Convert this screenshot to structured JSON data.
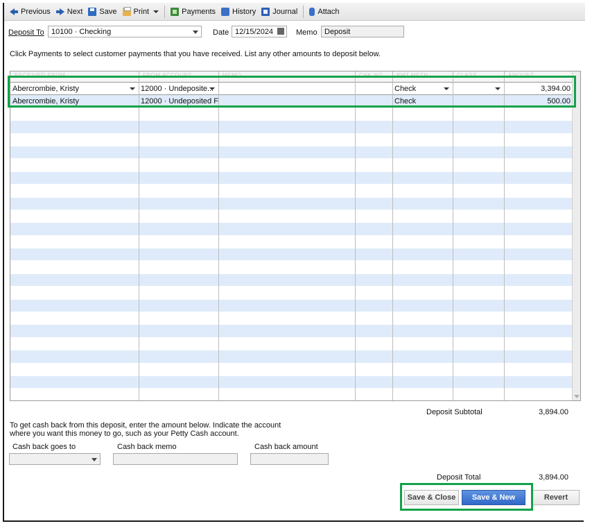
{
  "toolbar": {
    "previous": "Previous",
    "next": "Next",
    "save": "Save",
    "print": "Print",
    "payments": "Payments",
    "history": "History",
    "journal": "Journal",
    "attach": "Attach"
  },
  "header": {
    "deposit_to_label": "Deposit To",
    "deposit_to_value": "10100 · Checking",
    "date_label": "Date",
    "date_value": "12/15/2024",
    "memo_label": "Memo",
    "memo_value": "Deposit"
  },
  "instructions": "Click Payments to select customer payments that you have received. List any other amounts to deposit below.",
  "grid": {
    "columns": [
      "RECEIVED FROM",
      "FROM ACCOUNT",
      "MEMO",
      "CHK NO.",
      "PMT METH.",
      "CLASS",
      "AMOUNT"
    ],
    "rows": [
      {
        "received_from": "Abercrombie, Kristy",
        "from_account": "12000 · Undeposite...",
        "memo": "",
        "chk_no": "",
        "pmt_meth": "Check",
        "class": "",
        "amount": "3,394.00"
      },
      {
        "received_from": "Abercrombie, Kristy",
        "from_account": "12000 · Undeposited F...",
        "memo": "",
        "chk_no": "",
        "pmt_meth": "Check",
        "class": "",
        "amount": "500.00"
      }
    ]
  },
  "totals": {
    "subtotal_label": "Deposit Subtotal",
    "subtotal_value": "3,894.00",
    "total_label": "Deposit Total",
    "total_value": "3,894.00"
  },
  "cash_back": {
    "text_line1": "To get cash back from this deposit, enter the amount below.  Indicate the account",
    "text_line2": "where you want this money to go, such as your Petty Cash account.",
    "goes_to_label": "Cash back goes to",
    "memo_label": "Cash back memo",
    "amount_label": "Cash back amount"
  },
  "buttons": {
    "save_close": "Save & Close",
    "save_new": "Save & New",
    "revert": "Revert"
  },
  "colors": {
    "highlight": "#12a24a",
    "row_blue": "#dfebfa",
    "primary_button": "#3068c8"
  }
}
